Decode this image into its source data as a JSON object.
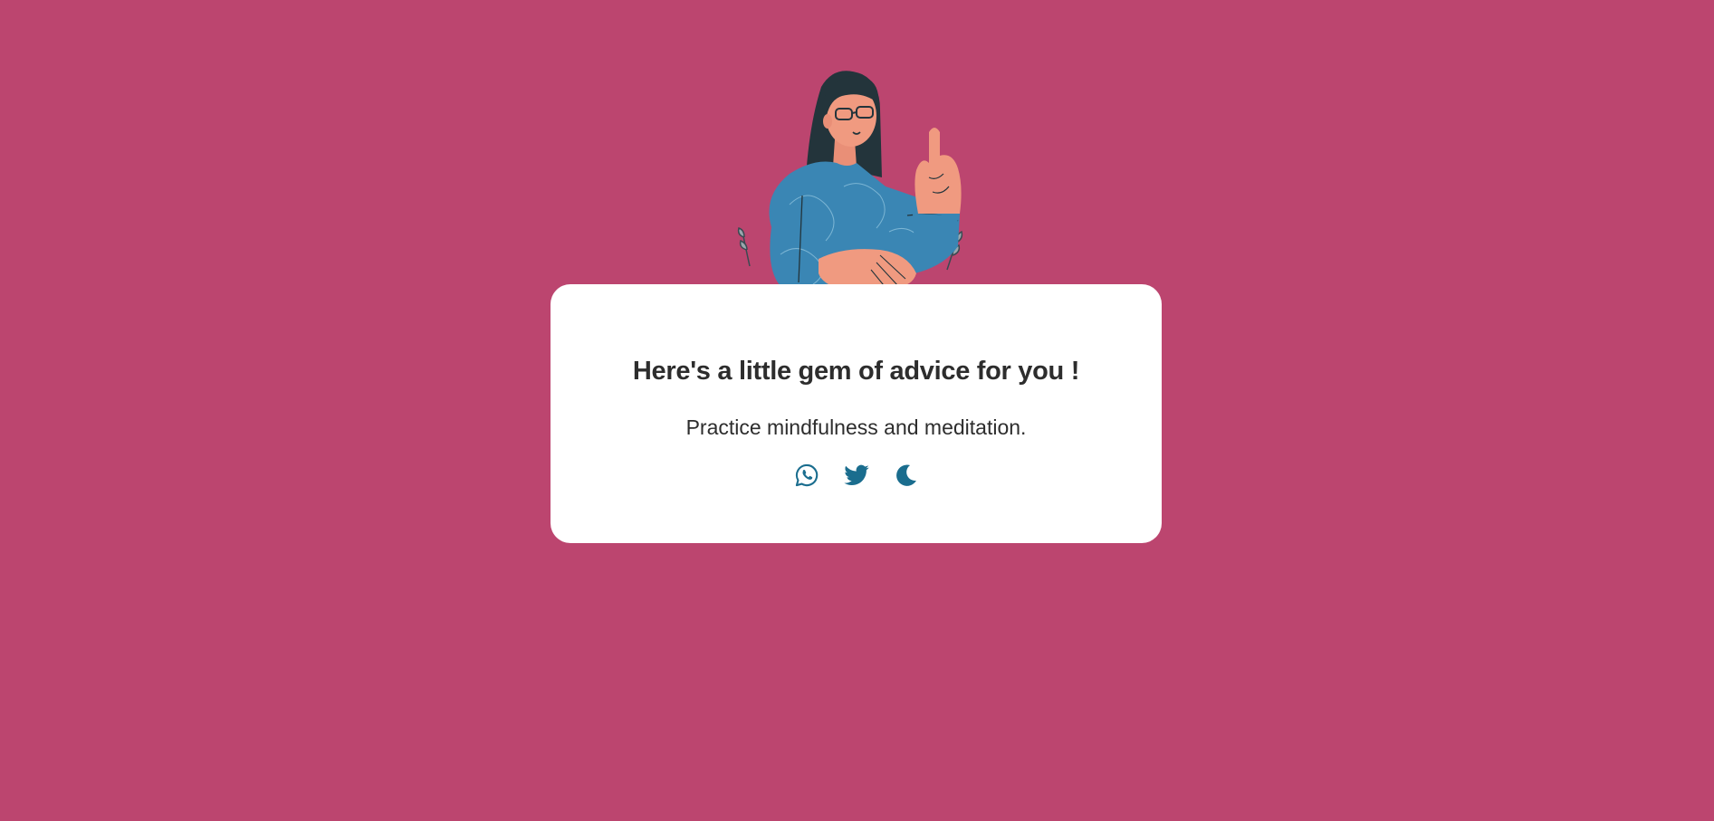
{
  "page": {
    "background": "#bc456f",
    "card_background": "#ffffff",
    "text_color": "#2d2d2d",
    "icon_color": "#1a6d8e"
  },
  "illustration": {
    "icon": "woman-pointing-illustration"
  },
  "card": {
    "title": "Here's a little gem of advice for you !",
    "advice": "Practice mindfulness and meditation."
  },
  "actions": [
    {
      "icon": "whatsapp-icon",
      "purpose": "share-whatsapp"
    },
    {
      "icon": "twitter-icon",
      "purpose": "share-twitter"
    },
    {
      "icon": "moon-icon",
      "purpose": "toggle-dark-mode"
    }
  ]
}
